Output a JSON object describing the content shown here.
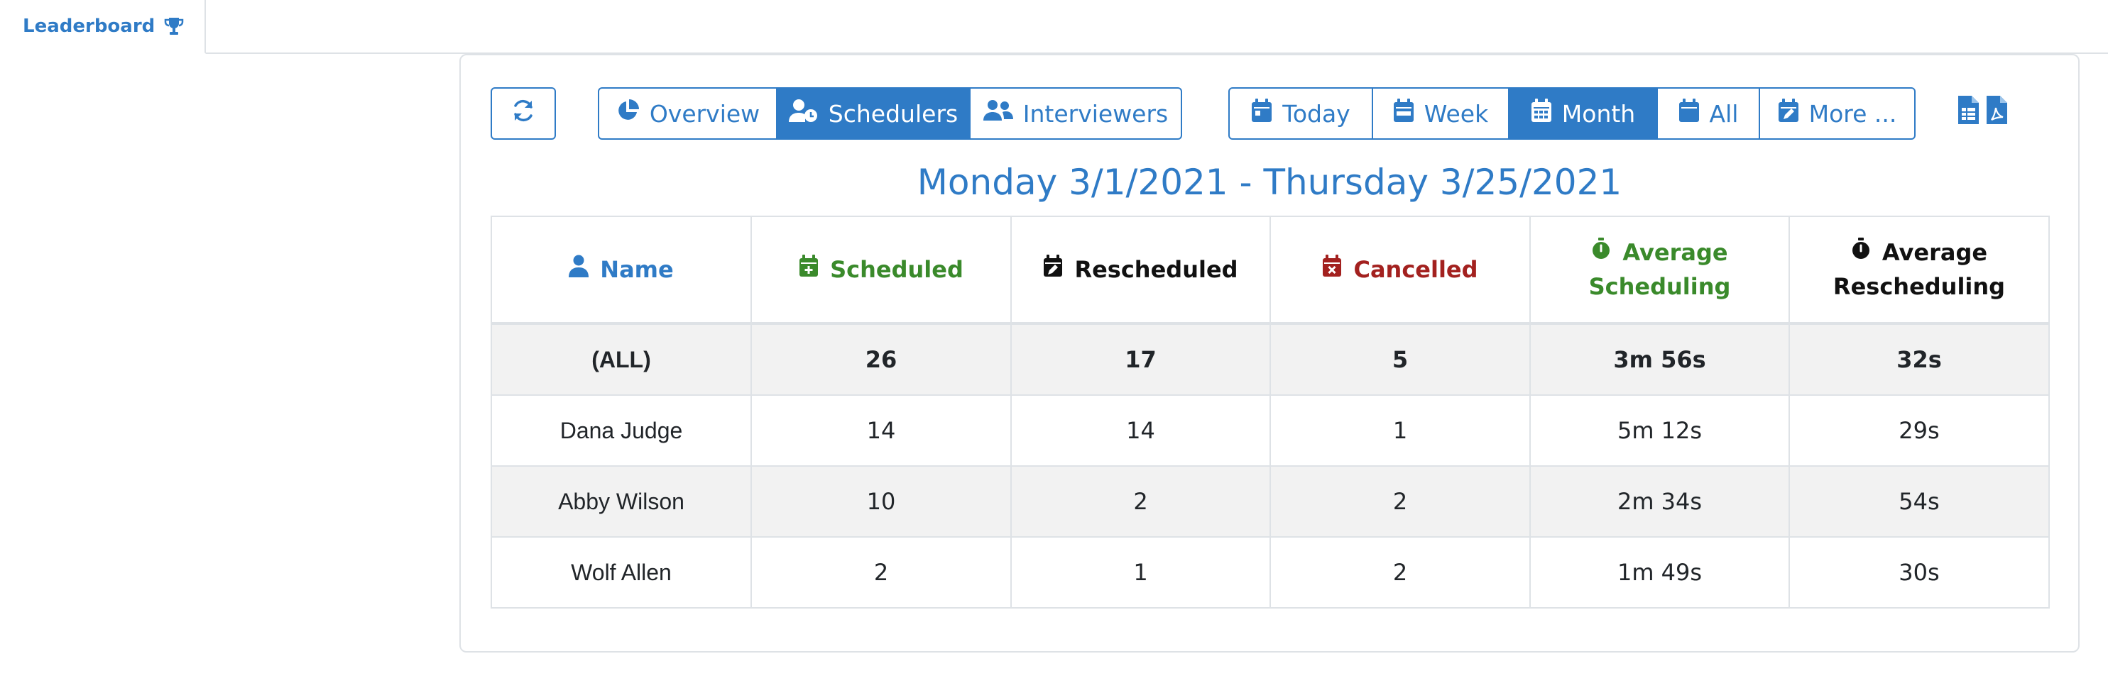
{
  "tab": {
    "label": "Leaderboard",
    "icon": "trophy-icon"
  },
  "toolbar": {
    "refresh_icon": "refresh-icon",
    "views": [
      {
        "label": "Overview",
        "icon": "pie-chart-icon",
        "active": false
      },
      {
        "label": "Schedulers",
        "icon": "user-clock-icon",
        "active": true
      },
      {
        "label": "Interviewers",
        "icon": "users-icon",
        "active": false
      }
    ],
    "periods": [
      {
        "label": "Today",
        "icon": "calendar-day-icon",
        "active": false
      },
      {
        "label": "Week",
        "icon": "calendar-week-icon",
        "active": false
      },
      {
        "label": "Month",
        "icon": "calendar-month-icon",
        "active": true
      },
      {
        "label": "All",
        "icon": "calendar-icon",
        "active": false
      },
      {
        "label": "More ...",
        "icon": "calendar-edit-icon",
        "active": false
      }
    ],
    "exports": [
      {
        "icon": "spreadsheet-file-icon"
      },
      {
        "icon": "pdf-file-icon"
      }
    ]
  },
  "date_range": "Monday 3/1/2021 - Thursday 3/25/2021",
  "table": {
    "columns": [
      {
        "label": "Name",
        "icon": "user-icon",
        "color": "#2f7bc6"
      },
      {
        "label": "Scheduled",
        "icon": "calendar-plus-icon",
        "color": "#3a8a2b"
      },
      {
        "label": "Rescheduled",
        "icon": "calendar-edit-icon",
        "color": "#111111"
      },
      {
        "label": "Cancelled",
        "icon": "calendar-x-icon",
        "color": "#a3211f"
      },
      {
        "label_line1": "Average",
        "label_line2": "Scheduling",
        "icon": "stopwatch-icon",
        "color": "#3a8a2b"
      },
      {
        "label_line1": "Average",
        "label_line2": "Rescheduling",
        "icon": "stopwatch-icon",
        "color": "#111111"
      }
    ],
    "rows": [
      {
        "name": "(ALL)",
        "scheduled": "26",
        "rescheduled": "17",
        "cancelled": "5",
        "avg_scheduling": "3m 56s",
        "avg_rescheduling": "32s"
      },
      {
        "name": "Dana Judge",
        "scheduled": "14",
        "rescheduled": "14",
        "cancelled": "1",
        "avg_scheduling": "5m 12s",
        "avg_rescheduling": "29s"
      },
      {
        "name": "Abby Wilson",
        "scheduled": "10",
        "rescheduled": "2",
        "cancelled": "2",
        "avg_scheduling": "2m 34s",
        "avg_rescheduling": "54s"
      },
      {
        "name": "Wolf Allen",
        "scheduled": "2",
        "rescheduled": "1",
        "cancelled": "2",
        "avg_scheduling": "1m 49s",
        "avg_rescheduling": "30s"
      }
    ]
  },
  "colors": {
    "primary": "#2f7bc6",
    "green": "#3a8a2b",
    "red": "#a3211f",
    "stripe": "#f2f2f2",
    "border": "#dee2e6"
  }
}
